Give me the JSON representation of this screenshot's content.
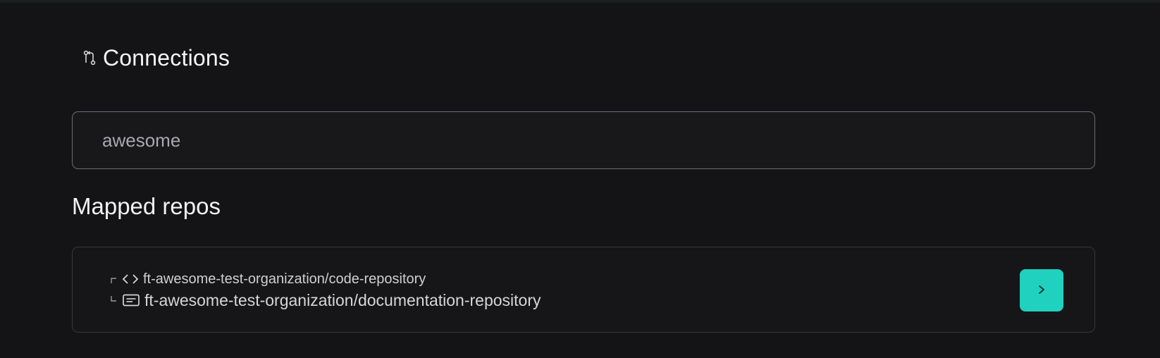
{
  "header": {
    "icon": "git-compare-icon",
    "title": "Connections"
  },
  "search": {
    "value": "awesome"
  },
  "mapped_repos": {
    "title": "Mapped repos",
    "items": [
      {
        "icon": "code-icon",
        "name": "ft-awesome-test-organization/code-repository"
      },
      {
        "icon": "document-icon",
        "name": "ft-awesome-test-organization/documentation-repository"
      }
    ],
    "open_button": {
      "icon": "chevron-right-icon",
      "label": ">"
    }
  },
  "colors": {
    "background": "#141416",
    "accent": "#1fd1be",
    "text": "#f2f2f2",
    "muted_text": "#a9a9ad"
  }
}
